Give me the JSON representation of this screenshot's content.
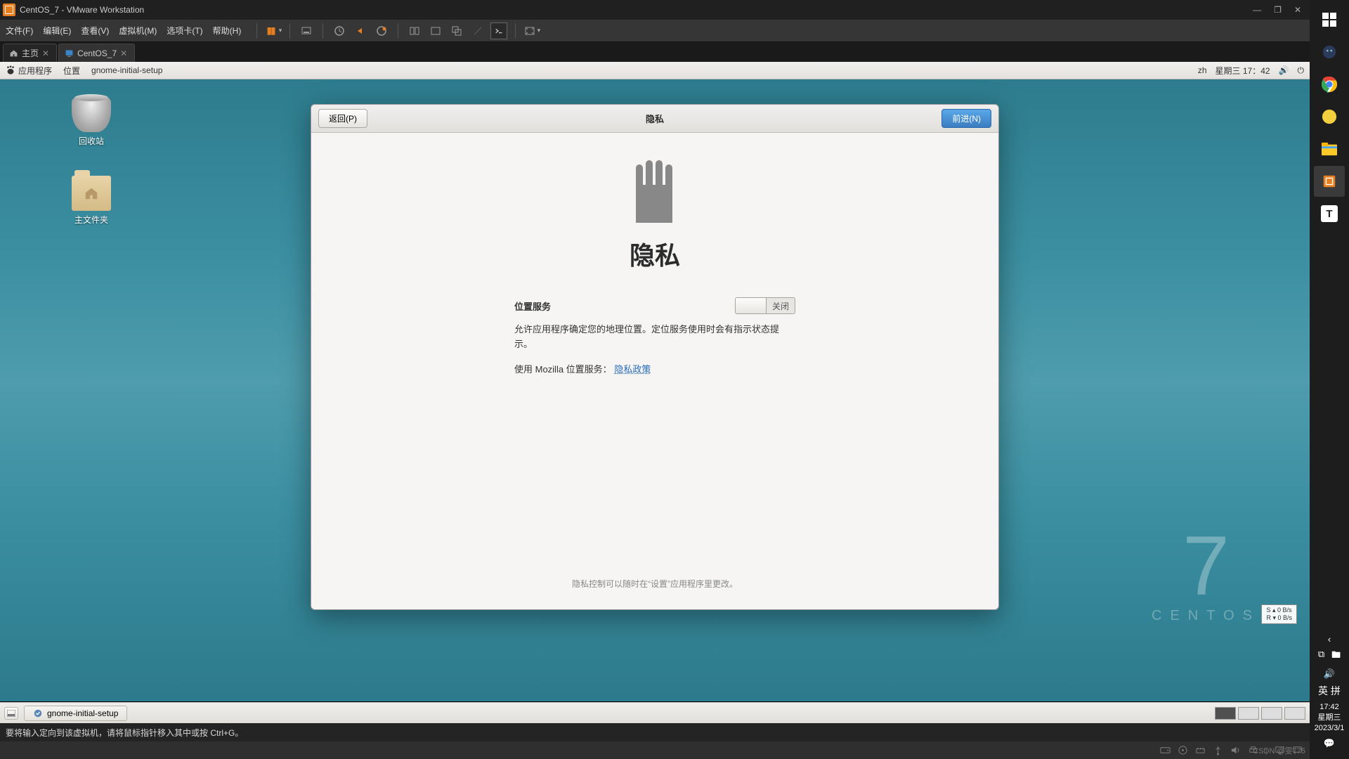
{
  "window": {
    "title": "CentOS_7 - VMware Workstation"
  },
  "menu": {
    "file": "文件(F)",
    "edit": "编辑(E)",
    "view": "查看(V)",
    "vm": "虚拟机(M)",
    "tabs": "选项卡(T)",
    "help": "帮助(H)",
    "pause": "▮▮"
  },
  "tabs": {
    "home": "主页",
    "vm": "CentOS_7"
  },
  "gnome_top": {
    "apps": "应用程序",
    "places": "位置",
    "proc": "gnome-initial-setup",
    "lang": "zh",
    "clock": "星期三 17：42"
  },
  "desktop": {
    "trash": "回收站",
    "home": "主文件夹"
  },
  "dialog": {
    "back": "返回(P)",
    "title": "隐私",
    "forward": "前进(N)",
    "big": "隐私",
    "loc_label": "位置服务",
    "switch_off": "关闭",
    "desc": "允许应用程序确定您的地理位置。定位服务使用时会有指示状态提示。",
    "mozilla_pre": "使用 Mozilla 位置服务：",
    "mozilla_link": "隐私政策",
    "footer": "隐私控制可以随时在“设置”应用程序里更改。"
  },
  "brand": {
    "seven": "7",
    "name": "CENTOS"
  },
  "net_overlay": {
    "l1": "S ▴   0 B/s",
    "l2": "R ▾   0 B/s"
  },
  "gnome_task": {
    "item": "gnome-initial-setup"
  },
  "vm_msg": "要将输入定向到该虚拟机，请将鼠标指针移入其中或按 Ctrl+G。",
  "win_tray": {
    "ime": "英  拼",
    "time": "17:42",
    "day": "星期三",
    "date": "2023/3/1"
  },
  "watermark": "CSDN @雯775"
}
